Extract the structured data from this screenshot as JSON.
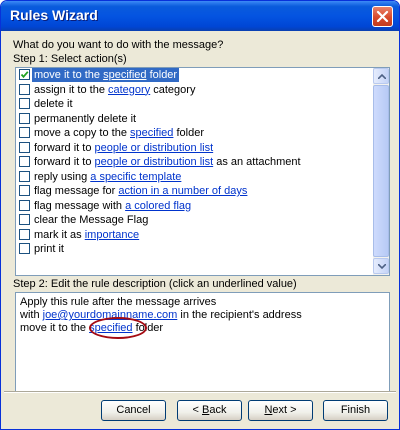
{
  "window": {
    "title": "Rules Wizard"
  },
  "step1": {
    "prompt": "What do you want to do with the message?",
    "heading": "Step 1: Select action(s)",
    "items": [
      {
        "checked": true,
        "selected": true,
        "parts": [
          {
            "t": "move it to the "
          },
          {
            "t": "specified",
            "link": true
          },
          {
            "t": " folder"
          }
        ]
      },
      {
        "checked": false,
        "parts": [
          {
            "t": "assign it to the "
          },
          {
            "t": "category",
            "link": true
          },
          {
            "t": " category"
          }
        ]
      },
      {
        "checked": false,
        "parts": [
          {
            "t": "delete it"
          }
        ]
      },
      {
        "checked": false,
        "parts": [
          {
            "t": "permanently delete it"
          }
        ]
      },
      {
        "checked": false,
        "parts": [
          {
            "t": "move a copy to the "
          },
          {
            "t": "specified",
            "link": true
          },
          {
            "t": " folder"
          }
        ]
      },
      {
        "checked": false,
        "parts": [
          {
            "t": "forward it to "
          },
          {
            "t": "people or distribution list",
            "link": true
          }
        ]
      },
      {
        "checked": false,
        "parts": [
          {
            "t": "forward it to "
          },
          {
            "t": "people or distribution list",
            "link": true
          },
          {
            "t": " as an attachment"
          }
        ]
      },
      {
        "checked": false,
        "parts": [
          {
            "t": "reply using "
          },
          {
            "t": "a specific template",
            "link": true
          }
        ]
      },
      {
        "checked": false,
        "parts": [
          {
            "t": "flag message for "
          },
          {
            "t": "action in a number of days",
            "link": true
          }
        ]
      },
      {
        "checked": false,
        "parts": [
          {
            "t": "flag message with "
          },
          {
            "t": "a colored flag",
            "link": true
          }
        ]
      },
      {
        "checked": false,
        "parts": [
          {
            "t": "clear the Message Flag"
          }
        ]
      },
      {
        "checked": false,
        "parts": [
          {
            "t": "mark it as "
          },
          {
            "t": "importance",
            "link": true
          }
        ]
      },
      {
        "checked": false,
        "parts": [
          {
            "t": "print it"
          }
        ]
      }
    ]
  },
  "step2": {
    "heading": "Step 2: Edit the rule description (click an underlined value)",
    "line1": "Apply this rule after the message arrives",
    "line2_pre": "with ",
    "line2_link": "joe@yourdomainname.com",
    "line2_post": " in the recipient's address",
    "line3_pre": "move it to the ",
    "line3_link": "specified",
    "line3_post": " folder"
  },
  "buttons": {
    "cancel": "Cancel",
    "back_underline": "B",
    "back_rest": "ack",
    "back_prefix": "< ",
    "next_underline": "N",
    "next_rest": "ext >",
    "finish": "Finish"
  },
  "icons": {
    "close": "close-icon",
    "check": "checkmark-icon",
    "scroll_up": "arrow-up-icon",
    "scroll_down": "arrow-down-icon"
  },
  "colors": {
    "title_bar": "#0454e1",
    "selection": "#316ac5",
    "link": "#0033cc",
    "annotation_circle": "#a40a12"
  }
}
